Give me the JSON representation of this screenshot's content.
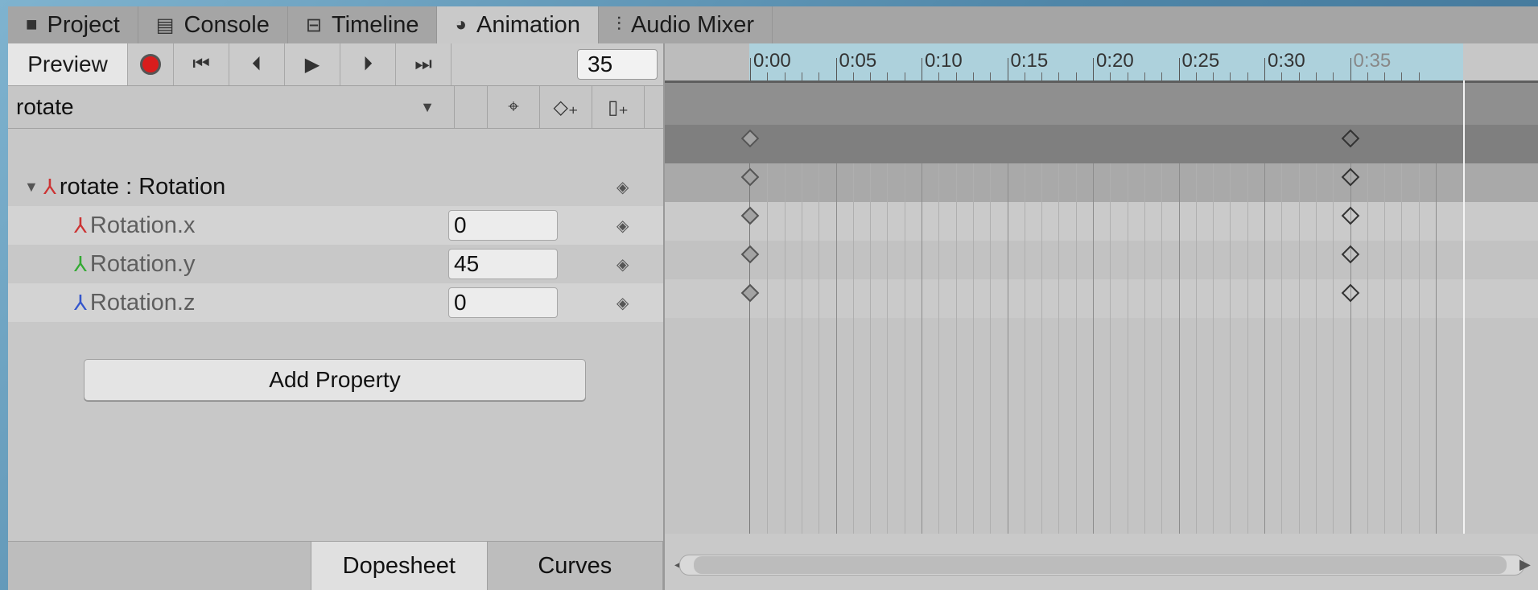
{
  "tabs": [
    {
      "label": "Project",
      "icon": "folder-icon",
      "glyph": "■",
      "active": false
    },
    {
      "label": "Console",
      "icon": "console-icon",
      "glyph": "▤",
      "active": false
    },
    {
      "label": "Timeline",
      "icon": "timeline-icon",
      "glyph": "⊟",
      "active": false
    },
    {
      "label": "Animation",
      "icon": "clock-icon",
      "glyph": "◕",
      "active": true
    },
    {
      "label": "Audio Mixer",
      "icon": "mixer-icon",
      "glyph": "⫶",
      "active": false
    }
  ],
  "toolbar": {
    "preview_label": "Preview",
    "record_icon": "record-icon",
    "first_key_icon": "⏮",
    "prev_key_icon": "⏴",
    "play_icon": "▶",
    "next_key_icon": "⏵",
    "last_key_icon": "⏭",
    "frame_value": "35"
  },
  "clip": {
    "name": "rotate",
    "caret": "▼",
    "add_keyframe_icon": "◇₊",
    "add_event_icon": "▯₊",
    "filter_icon": "⌖"
  },
  "properties": {
    "group_label": "rotate : Rotation",
    "group_caret": "▼",
    "axis_glyph": "⅄",
    "keyframe_glyph": "◈",
    "items": [
      {
        "label": "Rotation.x",
        "value": "0"
      },
      {
        "label": "Rotation.y",
        "value": "45"
      },
      {
        "label": "Rotation.z",
        "value": "0"
      }
    ]
  },
  "add_property_label": "Add Property",
  "bottom_tabs": {
    "dopesheet": "Dopesheet",
    "curves": "Curves",
    "active": "Dopesheet"
  },
  "timeline": {
    "ticks": [
      "0:00",
      "0:05",
      "0:10",
      "0:15",
      "0:20",
      "0:25",
      "0:30",
      "0:35"
    ],
    "current_frame": 35,
    "keyframe_times": [
      0,
      35
    ],
    "scroll_left_arrow": "◀",
    "scroll_right_arrow": "▶"
  },
  "colors": {
    "record": "#d91d1d",
    "ruler": "#add1dc",
    "axis_x": "#d33",
    "axis_y": "#3a3",
    "axis_z": "#35c"
  }
}
